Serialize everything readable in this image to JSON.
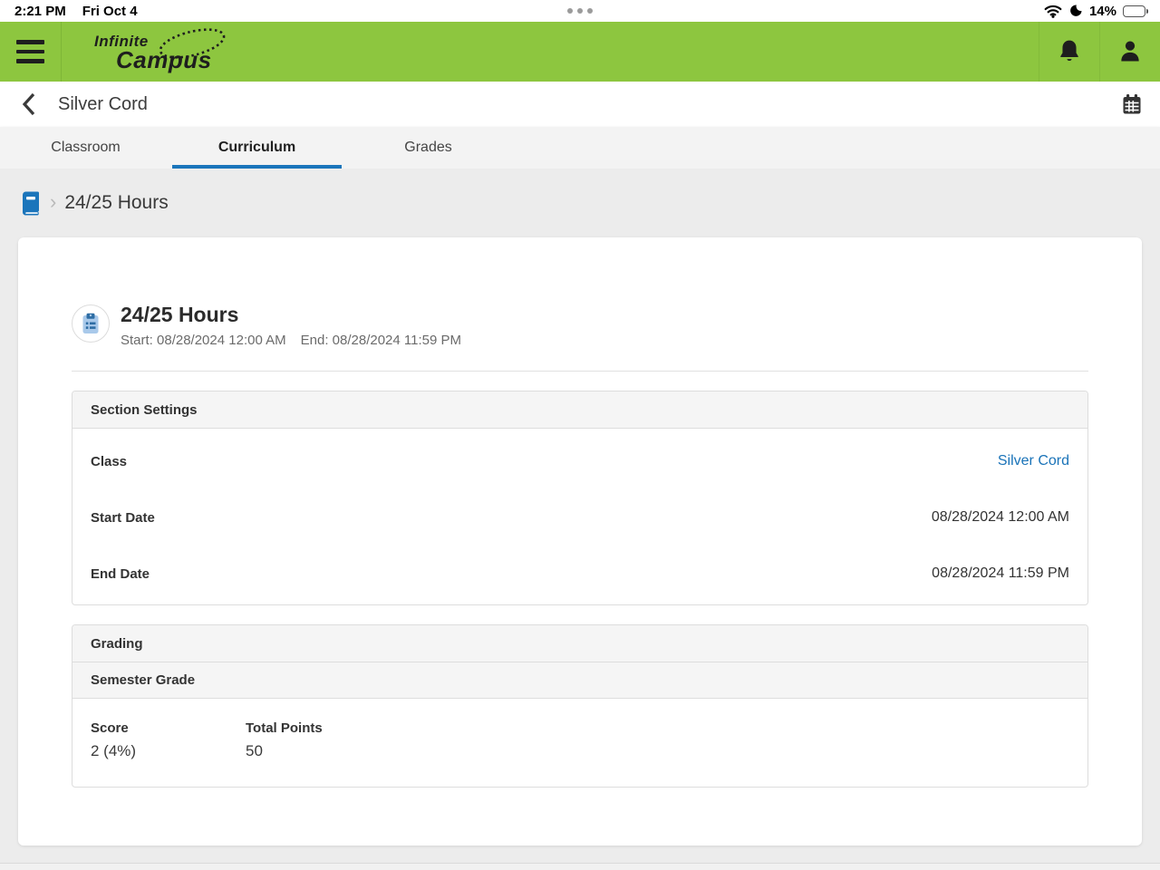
{
  "colors": {
    "header_green": "#8dc63f",
    "accent_blue": "#1b75bb",
    "link_blue": "#1a73b8",
    "page_background": "#ececec"
  },
  "status_bar": {
    "time": "2:21 PM",
    "date": "Fri Oct 4",
    "battery_percent": "14%"
  },
  "app_header": {
    "brand_line1": "Infinite",
    "brand_line2": "Campus"
  },
  "title_bar": {
    "title": "Silver Cord"
  },
  "tabs": [
    {
      "label": "Classroom",
      "active": false
    },
    {
      "label": "Curriculum",
      "active": true
    },
    {
      "label": "Grades",
      "active": false
    }
  ],
  "breadcrumb": {
    "separator": "›",
    "current": "24/25 Hours"
  },
  "assignment": {
    "title": "24/25 Hours",
    "start_label": "Start: 08/28/2024 12:00 AM",
    "end_label": "End: 08/28/2024 11:59 PM"
  },
  "section_settings": {
    "header": "Section Settings",
    "rows": [
      {
        "label": "Class",
        "value": "Silver Cord"
      },
      {
        "label": "Start Date",
        "value": "08/28/2024 12:00 AM"
      },
      {
        "label": "End Date",
        "value": "08/28/2024 11:59 PM"
      }
    ]
  },
  "grading": {
    "header": "Grading",
    "subheader": "Semester Grade",
    "score_label": "Score",
    "score_value": "2 (4%)",
    "total_points_label": "Total Points",
    "total_points_value": "50"
  },
  "icons": {
    "top": [
      "wifi-icon",
      "moon-icon",
      "battery-icon"
    ],
    "header": [
      "menu-icon",
      "bell-icon",
      "person-icon"
    ],
    "title_bar": [
      "back-icon",
      "calendar-icon"
    ],
    "breadcrumb": [
      "book-icon"
    ],
    "assignment": [
      "clipboard-icon"
    ]
  }
}
